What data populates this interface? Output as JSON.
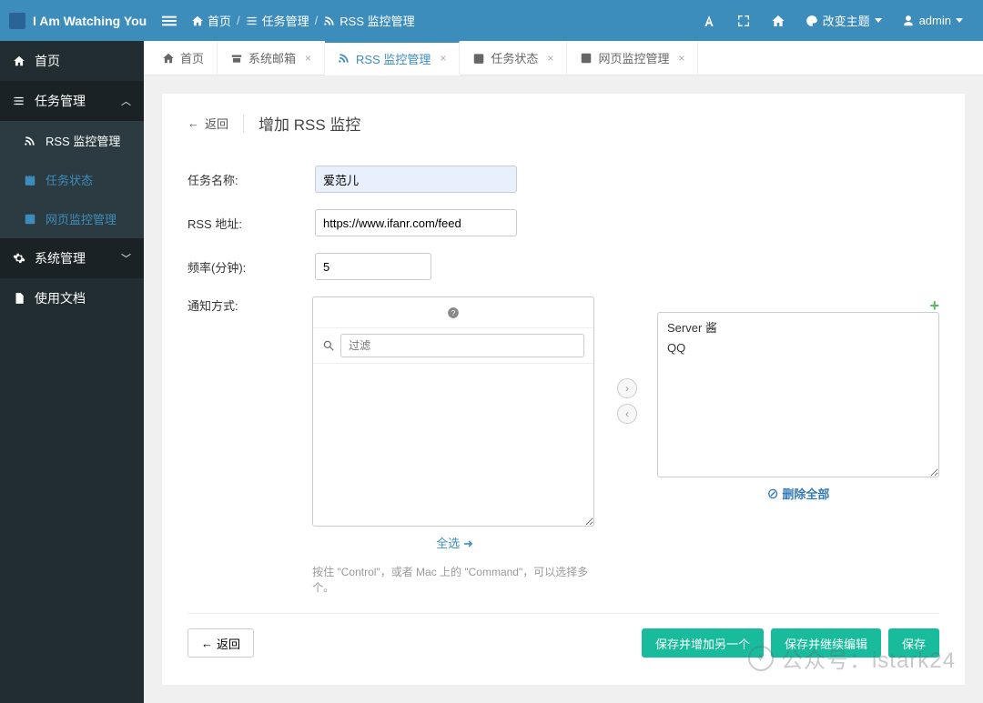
{
  "brand": "I Am Watching You",
  "breadcrumb": {
    "home": "首页",
    "task": "任务管理",
    "rss": "RSS 监控管理"
  },
  "topbar": {
    "theme": "改变主题",
    "user": "admin"
  },
  "sidebar": {
    "home": "首页",
    "task": "任务管理",
    "task_children": {
      "rss": "RSS 监控管理",
      "status": "任务状态",
      "web": "网页监控管理"
    },
    "system": "系统管理",
    "docs": "使用文档"
  },
  "tabs": {
    "home": "首页",
    "mailbox": "系统邮箱",
    "rss": "RSS 监控管理",
    "status": "任务状态",
    "web": "网页监控管理"
  },
  "page": {
    "back": "返回",
    "title": "增加 RSS 监控"
  },
  "form": {
    "name_label": "任务名称:",
    "name_value": "爱范儿",
    "rss_label": "RSS 地址:",
    "rss_value": "https://www.ifanr.com/feed",
    "freq_label": "频率(分钟):",
    "freq_value": "5",
    "notify_label": "通知方式:",
    "filter_placeholder": "过滤",
    "select_all": "全选",
    "hint": "按住 \"Control\"，或者 Mac 上的 \"Command\"，可以选择多个。",
    "selected": {
      "item1": "Server 酱",
      "item2": "QQ"
    },
    "remove_all": "删除全部"
  },
  "footer": {
    "back": "返回",
    "save_add": "保存并增加另一个",
    "save_continue": "保存并继续编辑",
    "save": "保存"
  },
  "watermark": "公众号：istark24"
}
